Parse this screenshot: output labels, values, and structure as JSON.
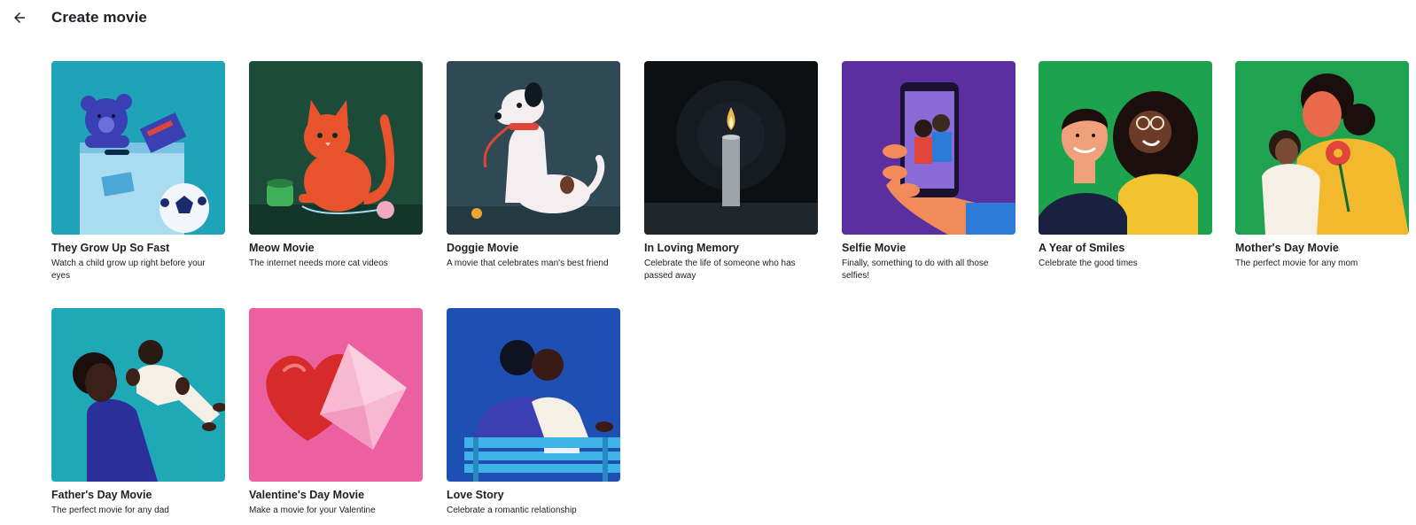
{
  "header": {
    "back_icon": "arrow-back-icon",
    "title": "Create movie"
  },
  "cards": [
    {
      "title": "They Grow Up So Fast",
      "description": "Watch a child grow up right before your eyes",
      "color": "#1fa3b8"
    },
    {
      "title": "Meow Movie",
      "description": "The internet needs more cat videos",
      "color": "#1d4b3a"
    },
    {
      "title": "Doggie Movie",
      "description": "A movie that celebrates man's best friend",
      "color": "#2f4a55"
    },
    {
      "title": "In Loving Memory",
      "description": "Celebrate the life of someone who has passed away",
      "color": "#0d1013"
    },
    {
      "title": "Selfie Movie",
      "description": "Finally, something to do with all those selfies!",
      "color": "#5b2fa0"
    },
    {
      "title": "A Year of Smiles",
      "description": "Celebrate the good times",
      "color": "#1da34e"
    },
    {
      "title": "Mother's Day Movie",
      "description": "The perfect movie for any mom",
      "color": "#1fa351"
    },
    {
      "title": "Father's Day Movie",
      "description": "The perfect movie for any dad",
      "color": "#1fa8b5"
    },
    {
      "title": "Valentine's Day Movie",
      "description": "Make a movie for your Valentine",
      "color": "#ec5fa0"
    },
    {
      "title": "Love Story",
      "description": "Celebrate a romantic relationship",
      "color": "#1e4fb3"
    }
  ]
}
